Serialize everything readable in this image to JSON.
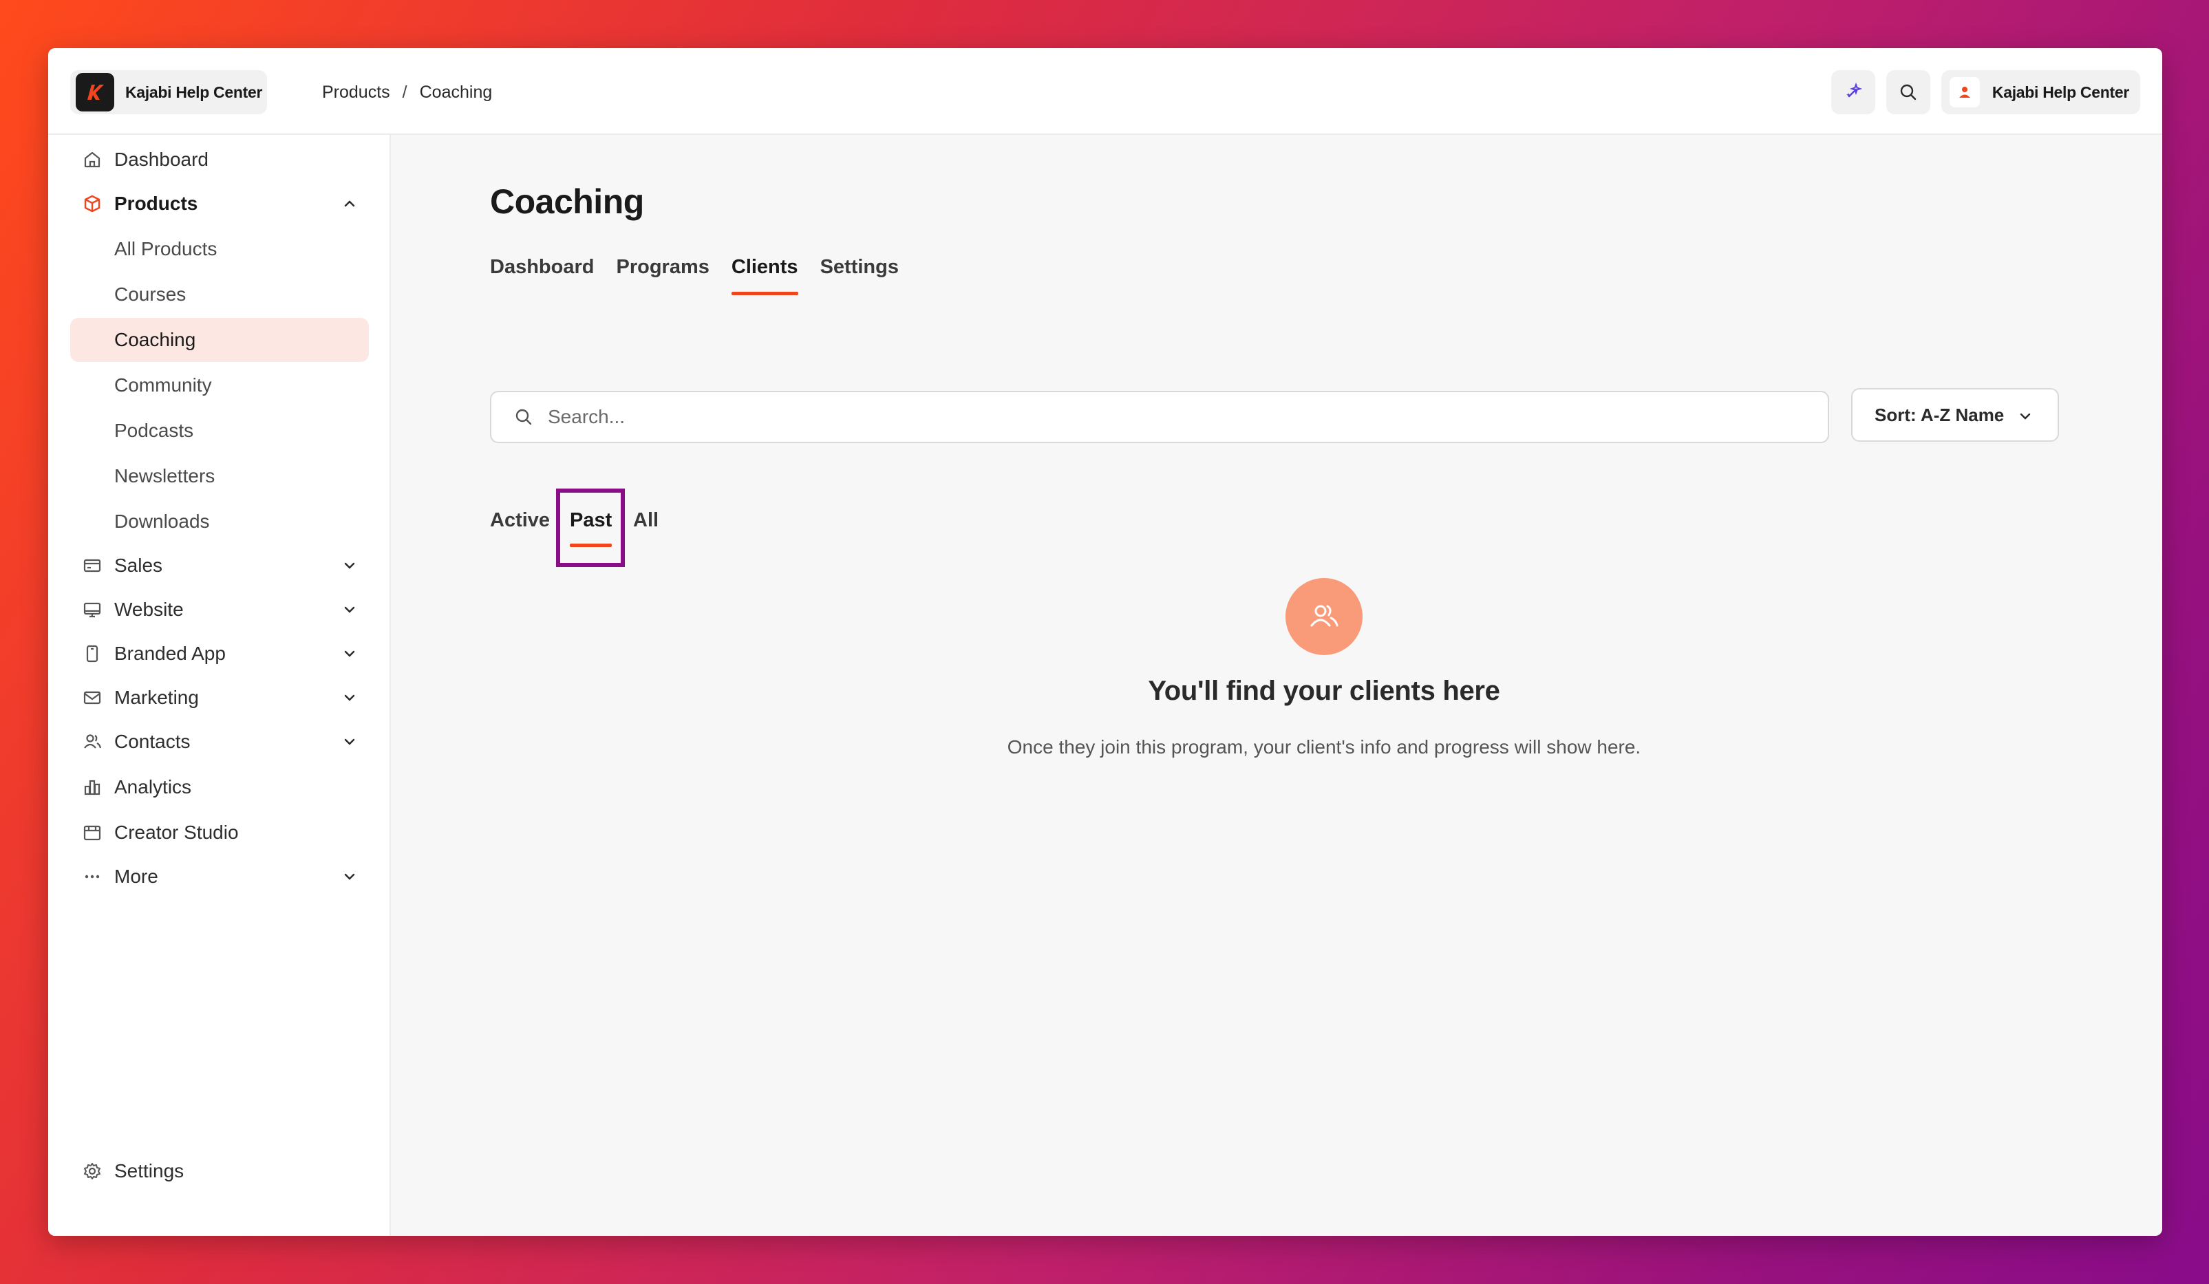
{
  "brand": {
    "name": "Kajabi Help Center"
  },
  "breadcrumb": {
    "root": "Products",
    "separator": "/",
    "current": "Coaching"
  },
  "top_right": {
    "ai_icon": "sparkle-icon",
    "search_icon": "search-icon",
    "user_name": "Kajabi Help Center"
  },
  "sidebar": {
    "items": [
      {
        "label": "Dashboard",
        "icon": "home-icon"
      },
      {
        "label": "Products",
        "icon": "box-icon",
        "expanded": true
      },
      {
        "label": "All Products"
      },
      {
        "label": "Courses"
      },
      {
        "label": "Coaching",
        "active": true
      },
      {
        "label": "Community"
      },
      {
        "label": "Podcasts"
      },
      {
        "label": "Newsletters"
      },
      {
        "label": "Downloads"
      },
      {
        "label": "Sales",
        "icon": "card-icon"
      },
      {
        "label": "Website",
        "icon": "monitor-icon"
      },
      {
        "label": "Branded App",
        "icon": "phone-icon"
      },
      {
        "label": "Marketing",
        "icon": "mail-icon"
      },
      {
        "label": "Contacts",
        "icon": "users-icon"
      },
      {
        "label": "Analytics",
        "icon": "bar-chart-icon"
      },
      {
        "label": "Creator Studio",
        "icon": "calendar-icon"
      },
      {
        "label": "More",
        "icon": "more-icon"
      }
    ],
    "settings_label": "Settings"
  },
  "main": {
    "title": "Coaching",
    "tabs": [
      "Dashboard",
      "Programs",
      "Clients",
      "Settings"
    ],
    "active_tab": "Clients",
    "search": {
      "placeholder": "Search..."
    },
    "sort": {
      "label": "Sort: A-Z Name"
    },
    "subtabs": [
      "Active",
      "Past",
      "All"
    ],
    "active_subtab": "Past",
    "empty_state": {
      "title": "You'll find your clients here",
      "description": "Once they join this program, your client's info and progress will show here."
    }
  },
  "colors": {
    "accent": "#f0451e",
    "highlight_box": "#8a0f86",
    "empty_icon_bg": "#f99a78",
    "active_nav_bg": "#fde7e2"
  }
}
